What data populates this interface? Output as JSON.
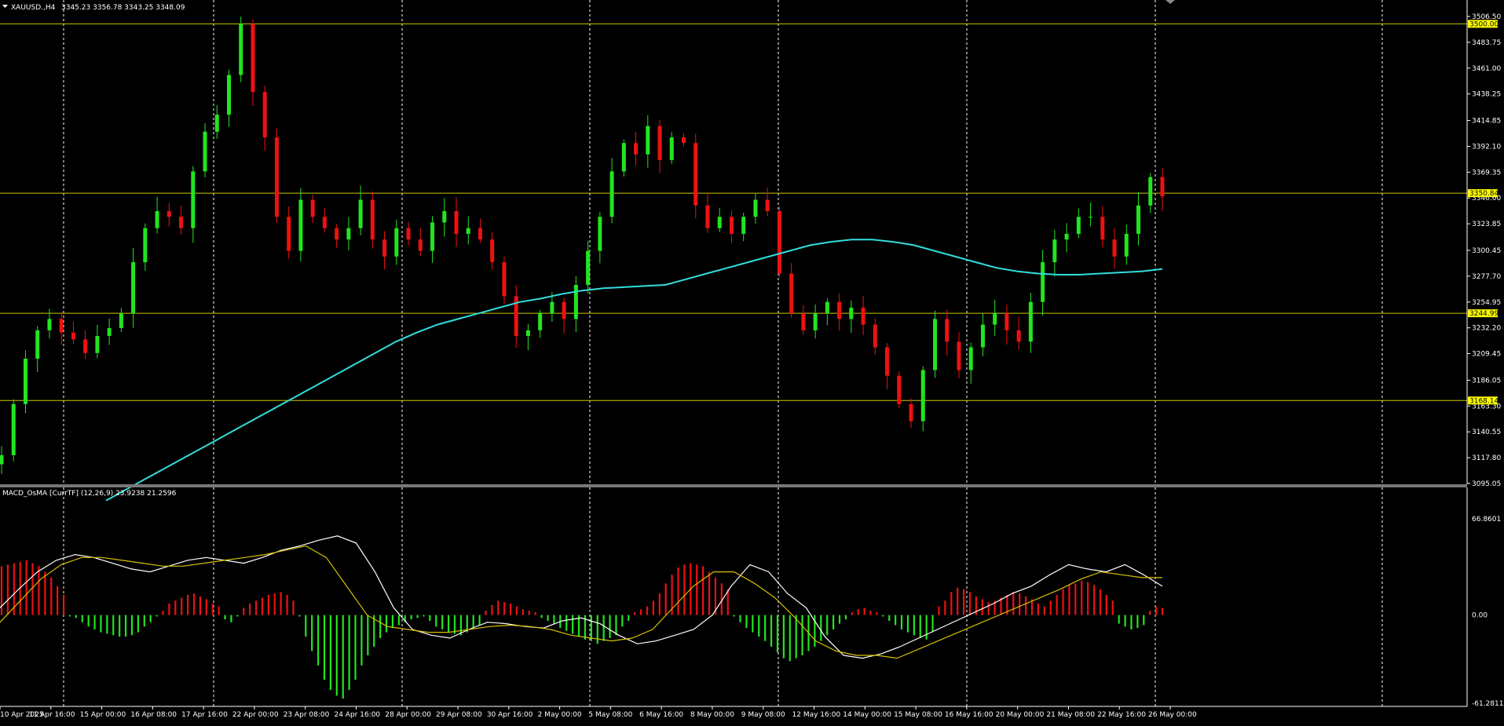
{
  "header": {
    "symbol": "XAUUSD.,H4",
    "ohlc": "3345.23 3356.78 3343.25 3348.09"
  },
  "macd_header": "MACD_OsMA [CurrTF] (12,26,9) 23.9238 21.2596",
  "colors": {
    "background": "#000000",
    "bull": "#22e51f",
    "bear": "#ee1111",
    "ma": "#33dddd",
    "level": "#c8c800",
    "level_label_bg": "#ffff00",
    "macd_line": "#ffffff",
    "signal_line": "#d4c000",
    "grid": "#ffffff"
  },
  "chart_data": [
    {
      "type": "candlestick",
      "name": "XAUUSD.,H4",
      "ylim": [
        3095.05,
        3506.5
      ],
      "y_ticks": [
        "3506.50",
        "3483.75",
        "3461.00",
        "3438.25",
        "3414.85",
        "3392.10",
        "3369.35",
        "3346.60",
        "3323.85",
        "3300.45",
        "3277.70",
        "3254.95",
        "3232.20",
        "3209.45",
        "3186.05",
        "3163.30",
        "3140.55",
        "3117.80",
        "3095.05"
      ],
      "horizontal_levels": [
        "3500.00",
        "3350.84",
        "3244.99",
        "3168.14"
      ],
      "x_labels": [
        "10 Apr 2025",
        "11 Apr 16:00",
        "15 Apr 00:00",
        "16 Apr 08:00",
        "17 Apr 16:00",
        "22 Apr 00:00",
        "23 Apr 08:00",
        "24 Apr 16:00",
        "28 Apr 00:00",
        "29 Apr 08:00",
        "30 Apr 16:00",
        "2 May 00:00",
        "5 May 08:00",
        "6 May 16:00",
        "8 May 00:00",
        "9 May 08:00",
        "12 May 16:00",
        "14 May 00:00",
        "15 May 08:00",
        "16 May 16:00",
        "20 May 00:00",
        "21 May 08:00",
        "22 May 16:00",
        "26 May 00:00"
      ],
      "close_path": [
        3120,
        3165,
        3205,
        3230,
        3240,
        3228,
        3222,
        3210,
        3225,
        3232,
        3245,
        3290,
        3320,
        3335,
        3330,
        3320,
        3370,
        3405,
        3420,
        3455,
        3500,
        3440,
        3400,
        3330,
        3300,
        3345,
        3330,
        3320,
        3310,
        3320,
        3345,
        3310,
        3295,
        3320,
        3310,
        3300,
        3325,
        3335,
        3315,
        3320,
        3310,
        3290,
        3260,
        3225,
        3230,
        3245,
        3255,
        3240,
        3270,
        3300,
        3330,
        3370,
        3395,
        3385,
        3410,
        3380,
        3400,
        3395,
        3340,
        3320,
        3330,
        3315,
        3330,
        3345,
        3335,
        3280,
        3245,
        3230,
        3245,
        3255,
        3240,
        3250,
        3235,
        3215,
        3190,
        3165,
        3150,
        3195,
        3240,
        3220,
        3195,
        3215,
        3235,
        3245,
        3230,
        3220,
        3255,
        3290,
        3310,
        3315,
        3330,
        3330,
        3310,
        3295,
        3315,
        3340,
        3365,
        3348
      ],
      "moving_average": [
        3080,
        3090,
        3100,
        3110,
        3120,
        3130,
        3140,
        3150,
        3160,
        3170,
        3180,
        3190,
        3200,
        3210,
        3220,
        3228,
        3235,
        3240,
        3245,
        3250,
        3255,
        3258,
        3262,
        3265,
        3267,
        3268,
        3269,
        3270,
        3275,
        3280,
        3285,
        3290,
        3295,
        3300,
        3305,
        3308,
        3310,
        3310,
        3308,
        3305,
        3300,
        3295,
        3290,
        3285,
        3282,
        3280,
        3279,
        3279,
        3280,
        3281,
        3282,
        3284
      ]
    },
    {
      "type": "macd_osma",
      "name": "MACD_OsMA [CurrTF] (12,26,9)",
      "ylim": [
        -61.2811,
        66.8601
      ],
      "y_ticks": [
        "66.8601",
        "0.00",
        "-61.2811"
      ],
      "histogram": [
        34,
        35,
        36,
        37,
        38,
        36,
        34,
        30,
        26,
        20,
        14,
        -1,
        -2,
        -5,
        -8,
        -10,
        -12,
        -13,
        -14,
        -15,
        -15,
        -14,
        -12,
        -8,
        -5,
        -1,
        3,
        8,
        10,
        12,
        14,
        15,
        13,
        11,
        8,
        6,
        -3,
        -5,
        -1,
        5,
        8,
        10,
        12,
        14,
        15,
        16,
        14,
        10,
        -1,
        -15,
        -25,
        -35,
        -45,
        -52,
        -56,
        -58,
        -52,
        -45,
        -35,
        -28,
        -22,
        -16,
        -12,
        -9,
        -7,
        -5,
        -3,
        -2,
        -1,
        -4,
        -8,
        -10,
        -12,
        -13,
        -14,
        -12,
        -9,
        -7,
        3,
        7,
        10,
        9,
        8,
        6,
        4,
        3,
        2,
        -2,
        -4,
        -6,
        -9,
        -11,
        -13,
        -15,
        -17,
        -18,
        -20,
        -18,
        -16,
        -14,
        -8,
        -4,
        2,
        4,
        6,
        10,
        15,
        22,
        28,
        33,
        35,
        36,
        35,
        34,
        30,
        26,
        22,
        18,
        -1,
        -5,
        -9,
        -12,
        -15,
        -18,
        -22,
        -26,
        -30,
        -32,
        -30,
        -28,
        -25,
        -22,
        -18,
        -14,
        -10,
        -6,
        -3,
        2,
        4,
        5,
        3,
        2,
        -1,
        -4,
        -7,
        -10,
        -12,
        -14,
        -16,
        -17,
        -12,
        6,
        10,
        16,
        19,
        18,
        16,
        13,
        11,
        9,
        10,
        12,
        14,
        16,
        15,
        13,
        11,
        8,
        6,
        10,
        14,
        18,
        21,
        22,
        24,
        23,
        21,
        18,
        14,
        10,
        -6,
        -8,
        -10,
        -9,
        -7,
        3,
        6,
        5
      ],
      "macd_line": [
        5,
        18,
        30,
        38,
        42,
        40,
        36,
        32,
        30,
        34,
        38,
        40,
        38,
        36,
        40,
        45,
        48,
        52,
        55,
        50,
        30,
        5,
        -10,
        -14,
        -16,
        -10,
        -5,
        -6,
        -8,
        -9,
        -4,
        -2,
        -6,
        -14,
        -20,
        -18,
        -14,
        -10,
        0,
        20,
        35,
        30,
        15,
        5,
        -15,
        -28,
        -30,
        -27,
        -22,
        -16,
        -10,
        -4,
        2,
        8,
        15,
        20,
        28,
        35,
        32,
        30,
        35,
        28,
        20
      ],
      "signal_line": [
        -5,
        10,
        25,
        35,
        40,
        40,
        38,
        36,
        34,
        34,
        36,
        38,
        40,
        42,
        45,
        48,
        40,
        20,
        0,
        -8,
        -10,
        -12,
        -12,
        -10,
        -8,
        -7,
        -8,
        -10,
        -14,
        -16,
        -18,
        -16,
        -10,
        5,
        20,
        30,
        30,
        22,
        12,
        -2,
        -18,
        -25,
        -28,
        -28,
        -30,
        -24,
        -18,
        -12,
        -6,
        0,
        6,
        12,
        18,
        25,
        30,
        28,
        26,
        26
      ]
    }
  ]
}
